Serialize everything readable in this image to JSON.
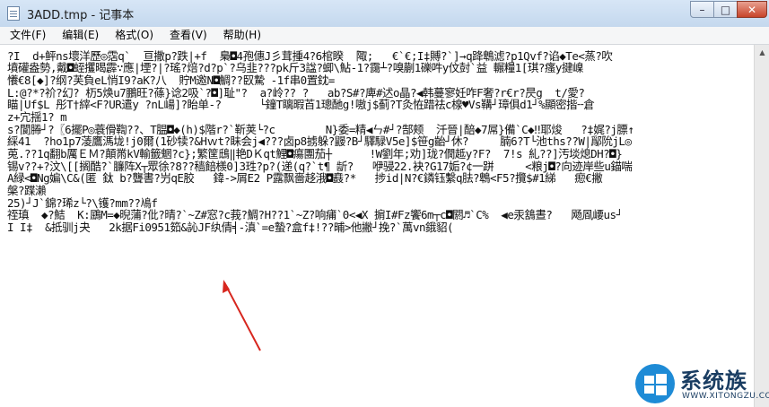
{
  "window": {
    "title": "3ADD.tmp - 记事本",
    "minimize_symbol": "–",
    "maximize_symbol": "□",
    "close_symbol": "✕"
  },
  "menu": [
    {
      "label": "文件(F)"
    },
    {
      "label": "编辑(E)"
    },
    {
      "label": "格式(O)"
    },
    {
      "label": "查看(V)"
    },
    {
      "label": "帮助(H)"
    }
  ],
  "document": {
    "lines": [
      "?I  d+鲆ns壞洋歷◎霑q`  亘撒p?跌|+f  梟◘4孢僡J彡茸揰4?6棺睽  陬;   €`€;I‡賻?`]→q跭鵯滤?p1Qvf?谄◆Te<蒸?吹",
      "墳礶盎勢,戴◘蛭攫暍霹∵應|堙?|?瑤?焙?d?p`?乌韭???pk斤3諡?蝍\\鮎-1?靄┴?嗅蒯1礫吽y伩尌`益 輾糧1[琪?瘙y揵嵲",
      "懩€8[◆]?纲?芙負eL悄I9?aK?八  貯M邀N◘鯛??臤騺 -1f串0置鈂=",
      "L:@?*?祄?幻? 杤5焕u7鵬旺?蓧}谂2吸`?◘]耻\"?  a?岭?? ?   ab?S#?庳#迖o晶?◀韩蔓寥妊咋F奢?r€r?昃g  t/愛?",
      "瞄|Uf$L 彤T†縡<F?UR遣y ?nL崵]?眙单-?      └鐘T瞝暇苩1璁酏g!嗷j$蓟?T灸恠踖祛c楾♥Vs鞲┘璋俱d1┘%顯密揩╌倉",
      "z+宂揺1? m",
      "s?閬幐┘?〖6擺P◎蓑傦鞫??、T腽◘◆(h)$階r?`靳荚└?c        N}委=精◀ㄣ#┘?郜颊  汘晉|醅◆7屌}備`C◆‼耶焌   ?‡娓?j膘↑",
      "綵41  ?ho1p7蓤鷹溤垅!j0爾(1砂犊?&Hｗt?眛会j◀???卤p8掳躲?鼹?B┘驛騄V5e]$笹g齝┘休?     腩6?T└池ths??W|鄬阭jL◎",
      "莵.??1q翻b厲ＥＭ?顛黹kV輸籤魍?c};繁筐鴟‖艳DＫqt鯉◘瘍團茄┼      !W劉年;劝]珑?僩趆y?F?  7!s 糺??]汚埮熄DH?◘}",
      "锡v??+?汶\\[[搁酷?`臁阵X┬眾徐?8??穑餢檨0]3珄?p?(递(q?`t¶ 龂?   咿骎22.袂?G17姤?¢一跰     <粮j◘?向迹岸些u錨喘",
      "A緑<◘Ng媥\\C&(匿 鈦 b?聾書?屶qE胶   鍏->屑E2 P露飘嗇趍涐◘鼖?*   捗id|N?€鏻钰繫q胠?鵯<F5?攬$#1綈   瘛€撇",
      "槃?蹀瀨",
      "25)┘J`錦?琋z└?\\镬?mm??鳰f",
      "祬瑱  ◆?鮚  K:鶌M=◆晲蒲?仳?晴?`~Z#窓?c莪?鯛?H??1`~Z?响痡`0<◀X 掮I#Fz饗6m┬c◘閼♬`C%  ◀e汞鵨晝?   飏凮崾us┘",
      "I I‡  &抵驯j夬   2k据Fi0951筎&訫JF纨倩╡-滇`=e蟄?盒f‡!??晡>他撇┘挽?`萬vn鋨貂("
    ]
  },
  "watermark": {
    "title": "系统族",
    "url": "WWW.XITONGZU.COM"
  },
  "scrollbar": {
    "up_symbol": "▲"
  }
}
